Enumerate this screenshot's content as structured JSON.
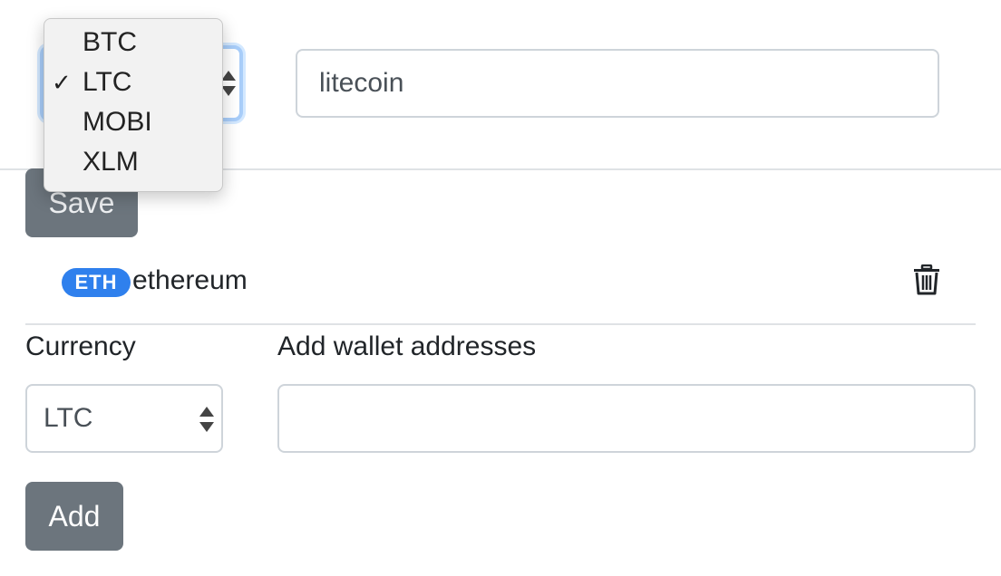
{
  "edit_form": {
    "currency_selected": "LTC",
    "wallet_address_value": "litecoin",
    "save_label": "Save"
  },
  "currency_dropdown": {
    "options": [
      "BTC",
      "LTC",
      "MOBI",
      "XLM"
    ],
    "selected": "LTC",
    "check_glyph": "✓"
  },
  "wallet_list": [
    {
      "currency_badge": "ETH",
      "address": "ethereum",
      "delete_icon": "trash-icon"
    }
  ],
  "add_form": {
    "currency_label": "Currency",
    "currency_selected": "LTC",
    "wallet_label": "Add wallet addresses",
    "wallet_value": "",
    "add_label": "Add"
  },
  "colors": {
    "button_bg": "#6c757d",
    "badge_bg": "#2f80ed",
    "focus_ring": "#a8cdf9"
  }
}
